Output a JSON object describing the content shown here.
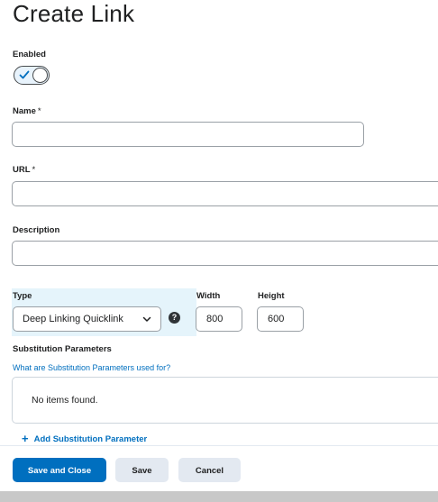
{
  "page": {
    "title": "Create Link"
  },
  "enabled": {
    "label": "Enabled",
    "state": true
  },
  "name_field": {
    "label": "Name",
    "required_marker": "*",
    "value": ""
  },
  "url_field": {
    "label": "URL",
    "required_marker": "*",
    "value": ""
  },
  "description_field": {
    "label": "Description",
    "value": ""
  },
  "type_field": {
    "label": "Type",
    "value": "Deep Linking Quicklink",
    "help_icon": "?"
  },
  "width_field": {
    "label": "Width",
    "value": "800"
  },
  "height_field": {
    "label": "Height",
    "value": "600"
  },
  "substitution": {
    "label": "Substitution Parameters",
    "help_link": "What are Substitution Parameters used for?",
    "empty_text": "No items found.",
    "add_label": "Add Substitution Parameter",
    "add_icon": "+"
  },
  "buttons": {
    "save_close": "Save and Close",
    "save": "Save",
    "cancel": "Cancel"
  },
  "colors": {
    "primary": "#006fbf",
    "secondary_button": "#e3e9f1",
    "type_highlight": "#e5f4fb"
  }
}
